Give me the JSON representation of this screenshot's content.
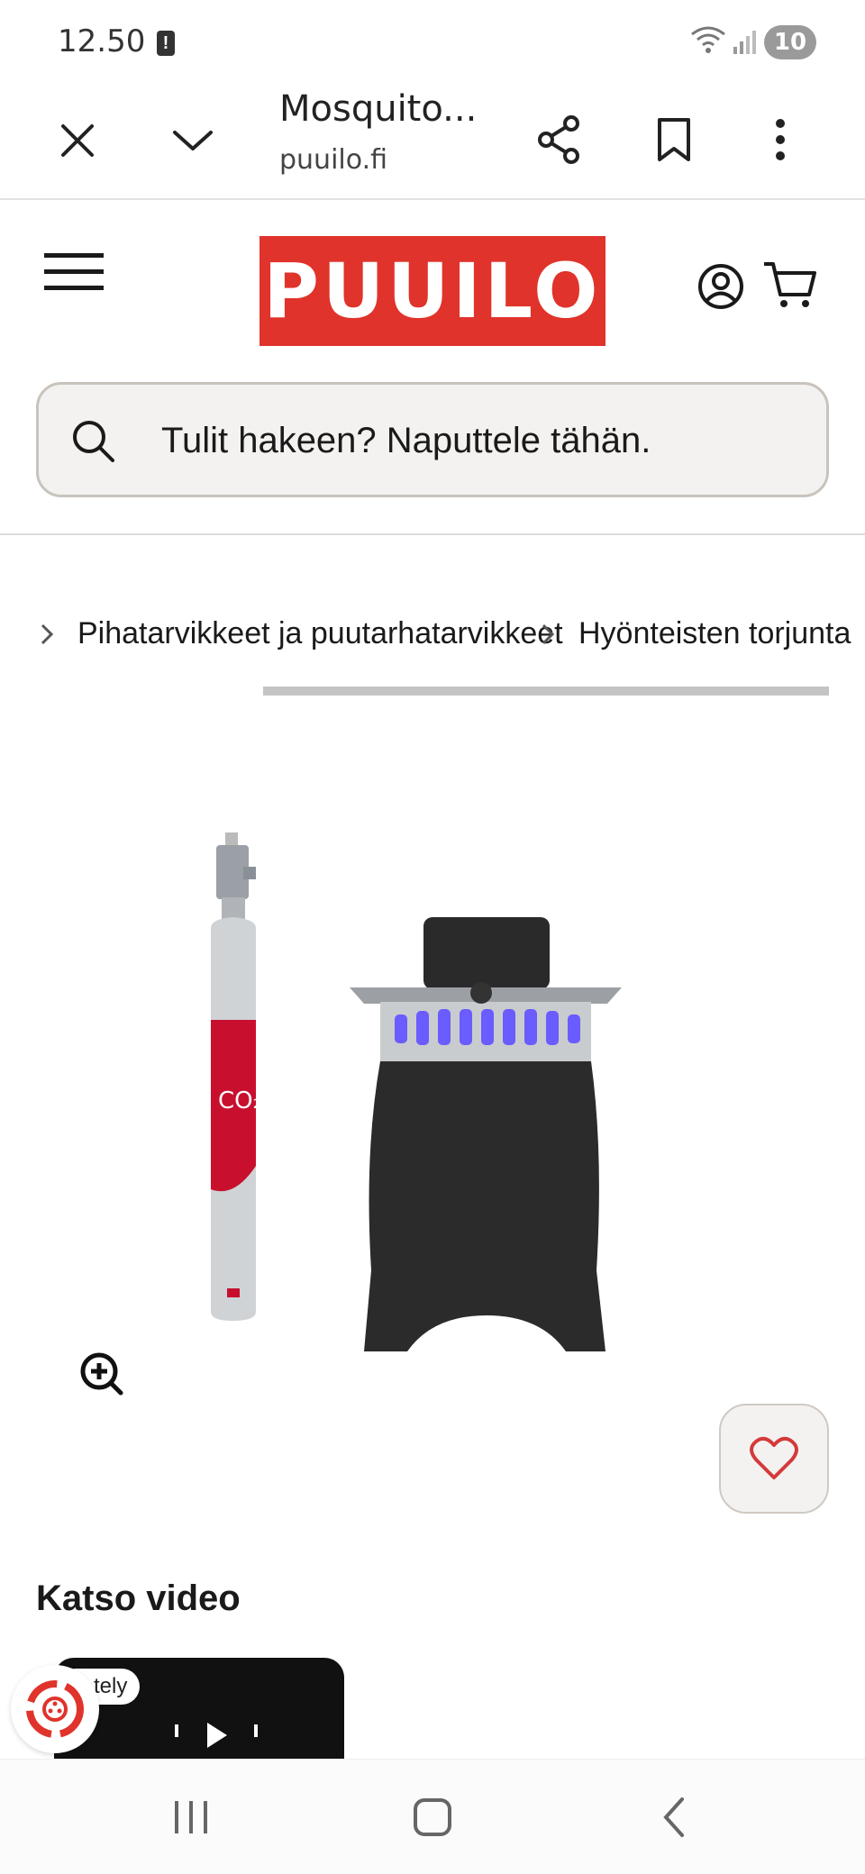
{
  "status_bar": {
    "time": "12.50",
    "battery_level": "10"
  },
  "browser": {
    "page_title": "Mosquito...",
    "domain": "puuilo.fi"
  },
  "site": {
    "logo_text": "PUUILO",
    "search_placeholder": "Tulit hakeen? Naputtele tähän."
  },
  "breadcrumb": {
    "items": [
      "Pihatarvikkeet ja puutarhatarvikkeet",
      "Hyönteisten torjunta"
    ]
  },
  "product": {
    "image_alt": "Mosquito trap with CO2 cylinder",
    "cylinder_label": "CO₂"
  },
  "video": {
    "heading": "Katso video",
    "chip_text": "tely"
  },
  "colors": {
    "brand": "#e0332b",
    "search_bg": "#f4f2f0",
    "favorite_icon": "#d33a3a"
  }
}
